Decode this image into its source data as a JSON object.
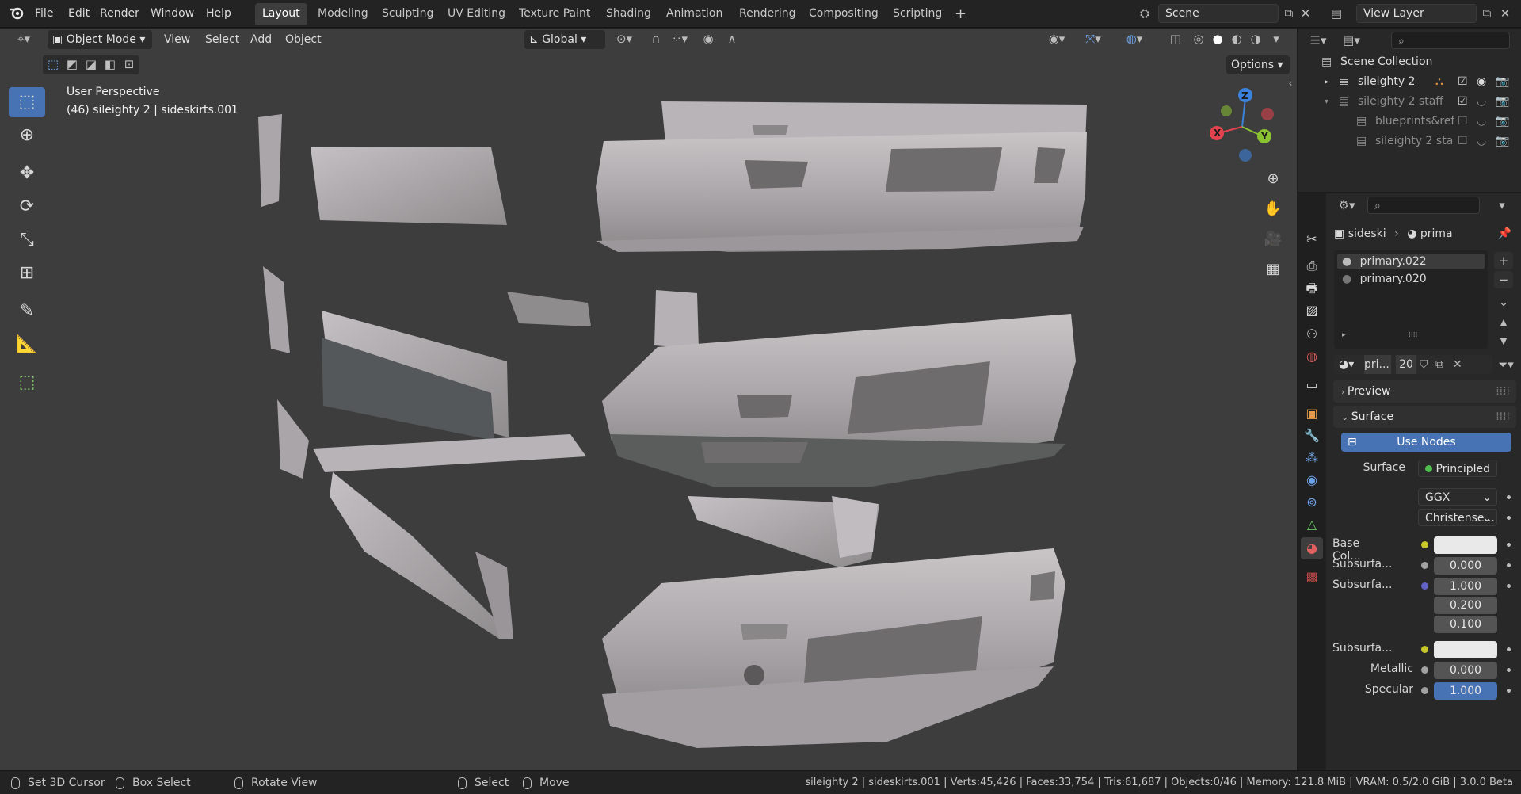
{
  "menubar": {
    "items": [
      "File",
      "Edit",
      "Render",
      "Window",
      "Help"
    ],
    "workspaces": [
      "Layout",
      "Modeling",
      "Sculpting",
      "UV Editing",
      "Texture Paint",
      "Shading",
      "Animation",
      "Rendering",
      "Compositing",
      "Scripting"
    ],
    "active_workspace": "Layout",
    "add_tab": "+",
    "scene": "Scene",
    "view_layer": "View Layer"
  },
  "viewport": {
    "mode": "Object Mode",
    "menus": [
      "View",
      "Select",
      "Add",
      "Object"
    ],
    "orientation": "Global",
    "options": "Options",
    "perspective": "User Perspective",
    "object_info": "(46) sileighty 2 | sideskirts.001",
    "gizmo": {
      "x": "X",
      "y": "Y",
      "z": "Z"
    }
  },
  "toolbar": {
    "tools": [
      "select-box",
      "cursor",
      "move",
      "rotate",
      "scale",
      "transform",
      "annotate",
      "measure",
      "add-cube"
    ],
    "active": "select-box"
  },
  "outliner": {
    "root": "Scene Collection",
    "items": [
      {
        "label": "sileighty 2",
        "level": 1,
        "expanded": false,
        "checked": true
      },
      {
        "label": "sileighty 2 staff",
        "level": 1,
        "expanded": true,
        "checked": true
      },
      {
        "label": "blueprints&ref",
        "level": 2,
        "checked": false
      },
      {
        "label": "sileighty 2 sta",
        "level": 2,
        "checked": false
      }
    ]
  },
  "properties": {
    "breadcrumb": {
      "object": "sideski",
      "material": "prima"
    },
    "slots": [
      "primary.022",
      "primary.020"
    ],
    "active_slot": "primary.022",
    "material_name": "pri...",
    "users": "20",
    "panels": {
      "preview": "Preview",
      "surface": "Surface"
    },
    "use_nodes": "Use Nodes",
    "surface_label": "Surface",
    "surface_shader": "Principled ...",
    "distribution": "GGX",
    "subsurface_method": "Christense...",
    "rows": [
      {
        "label": "Base Col...",
        "value": "",
        "socket": "#c7c729",
        "kind": "color"
      },
      {
        "label": "Subsurfa...",
        "value": "0.000",
        "socket": "#a1a1a1",
        "kind": "num"
      },
      {
        "label": "Subsurfa...",
        "values": [
          "1.000",
          "0.200",
          "0.100"
        ],
        "socket": "#6363c7",
        "kind": "vec"
      },
      {
        "label": "Subsurfa...",
        "value": "",
        "socket": "#c7c729",
        "kind": "color"
      },
      {
        "label": "Metallic",
        "value": "0.000",
        "socket": "#a1a1a1",
        "kind": "num"
      },
      {
        "label": "Specular",
        "value": "1.000",
        "socket": "#a1a1a1",
        "kind": "num-active"
      }
    ]
  },
  "statusbar": {
    "hints": [
      "Set 3D Cursor",
      "Box Select",
      "Rotate View",
      "Select",
      "Move"
    ],
    "stats": "sileighty 2 | sideskirts.001 | Verts:45,426 | Faces:33,754 | Tris:61,687 | Objects:0/46 | Memory: 121.8 MiB | VRAM: 0.5/2.0 GiB | 3.0.0 Beta"
  },
  "colors": {
    "accent": "#4772b3",
    "viewport_bg": "#3d3d3d",
    "panel_bg": "#282828",
    "x_axis": "#e3434f",
    "y_axis": "#8bc232",
    "z_axis": "#3c82db"
  }
}
